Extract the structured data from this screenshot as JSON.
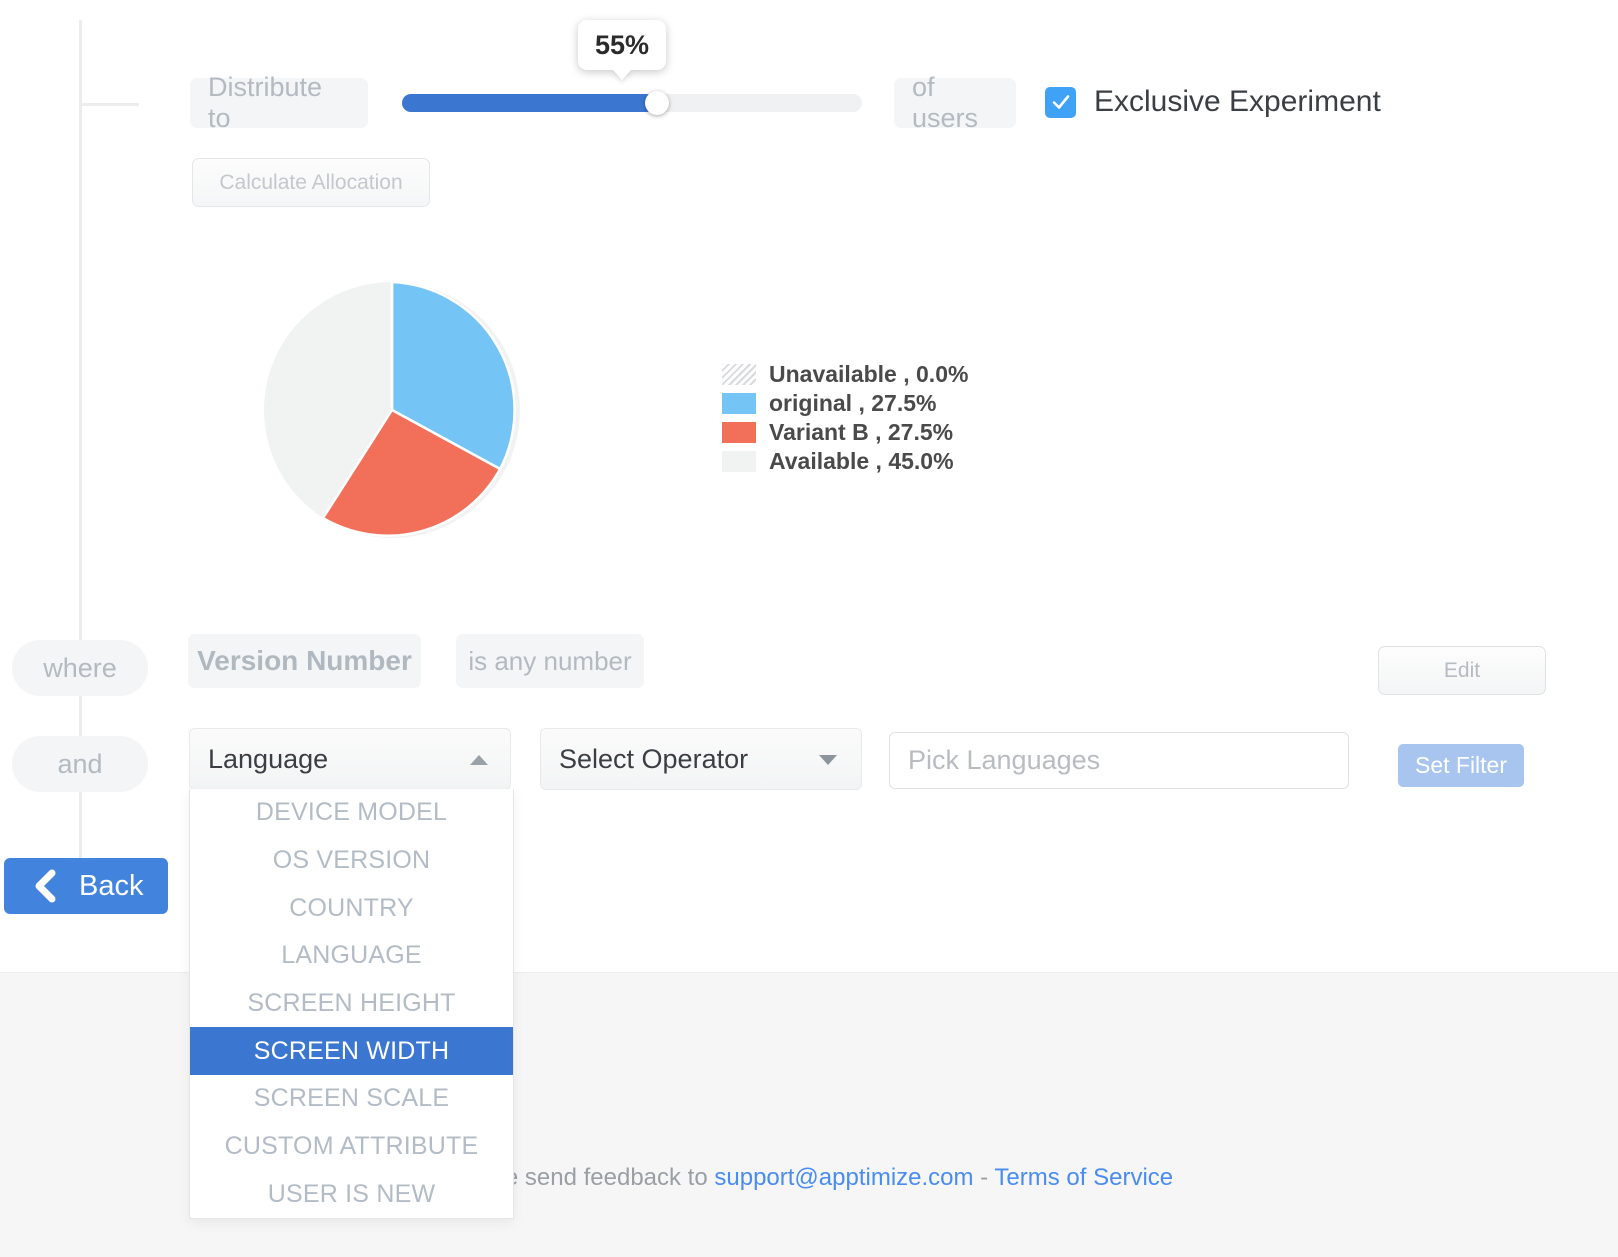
{
  "allocation": {
    "distribute_label": "Distribute to",
    "of_users_label": "of users",
    "slider_value_label": "55%",
    "slider_percent": 55,
    "exclusive_label": "Exclusive Experiment",
    "exclusive_checked": true,
    "calculate_label": "Calculate Allocation"
  },
  "chart_data": {
    "type": "pie",
    "title": "",
    "legend_position": "right",
    "categories": [
      "Unavailable",
      "original",
      "Variant B",
      "Available"
    ],
    "values": [
      0.0,
      27.5,
      27.5,
      45.0
    ],
    "colors": [
      "#e6e8ea",
      "#74c4f5",
      "#f2705a",
      "#f1f2f2"
    ],
    "legend": [
      {
        "label": "Unavailable , 0.0%",
        "swatch": "hatch",
        "color": "#d8dade"
      },
      {
        "label": "original , 27.5%",
        "swatch": "solid",
        "color": "#74c4f5"
      },
      {
        "label": "Variant B , 27.5%",
        "swatch": "solid",
        "color": "#f2705a"
      },
      {
        "label": "Available , 45.0%",
        "swatch": "solid",
        "color": "#f1f2f2"
      }
    ]
  },
  "targeting": {
    "where_label": "where",
    "and_label": "and",
    "existing_rule": {
      "attribute": "Version Number",
      "operator": "is any number",
      "edit_label": "Edit"
    },
    "new_rule": {
      "attribute_value": "Language",
      "operator_value": "Select Operator",
      "values_placeholder": "Pick Languages",
      "values_value": "",
      "set_filter_label": "Set Filter",
      "attribute_options": [
        "DEVICE MODEL",
        "OS VERSION",
        "COUNTRY",
        "LANGUAGE",
        "SCREEN HEIGHT",
        "SCREEN WIDTH",
        "SCREEN SCALE",
        "CUSTOM ATTRIBUTE",
        "USER IS NEW"
      ],
      "attribute_highlighted": "SCREEN WIDTH"
    }
  },
  "nav": {
    "back_label": "Back"
  },
  "footer": {
    "prefix": "Please send feedback to ",
    "email": "support@apptimize.com",
    "separator": " - ",
    "terms": "Terms of Service"
  },
  "theme": {
    "accent_blue": "#3b77d1",
    "checkbox_blue": "#3fa2f7",
    "link_blue": "#4a8cf0",
    "pill_gray": "#f4f5f6",
    "muted_text": "#b3bac2"
  }
}
